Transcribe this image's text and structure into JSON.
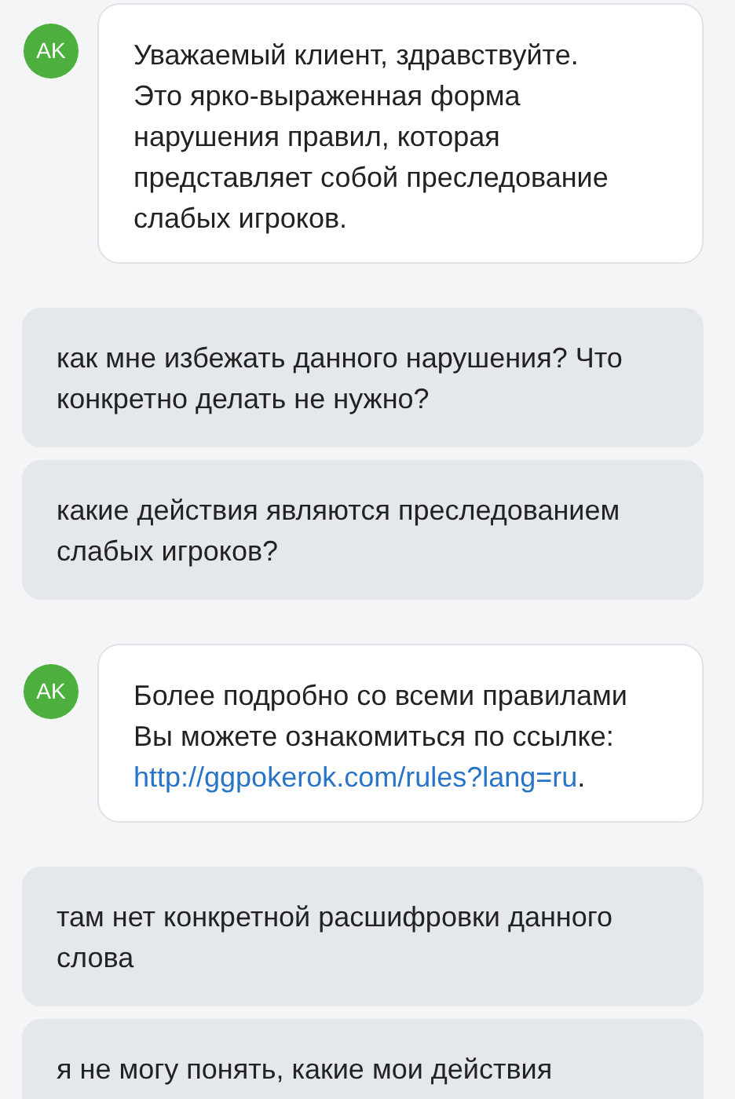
{
  "messages": [
    {
      "kind": "agent",
      "avatar": "AK",
      "text": "Уважаемый клиент, здравствуйте. Это ярко-выраженная форма нарушения правил, которая представляет собой преследование слабых игроков."
    },
    {
      "kind": "user",
      "text": "как мне избежать данного нарушения? Что конкретно делать не нужно?"
    },
    {
      "kind": "user",
      "text": "какие действия являются преследованием слабых игроков?"
    },
    {
      "kind": "agent",
      "avatar": "AK",
      "text": "Более подробно со всеми правилами Вы можете ознакомиться по ссылке:",
      "link": "http://ggpokerok.com/rules?lang=ru",
      "after": "."
    },
    {
      "kind": "user",
      "text": "там нет конкретной расшифровки данного слова"
    },
    {
      "kind": "user",
      "text": "я не могу понять, какие мои действия"
    }
  ]
}
